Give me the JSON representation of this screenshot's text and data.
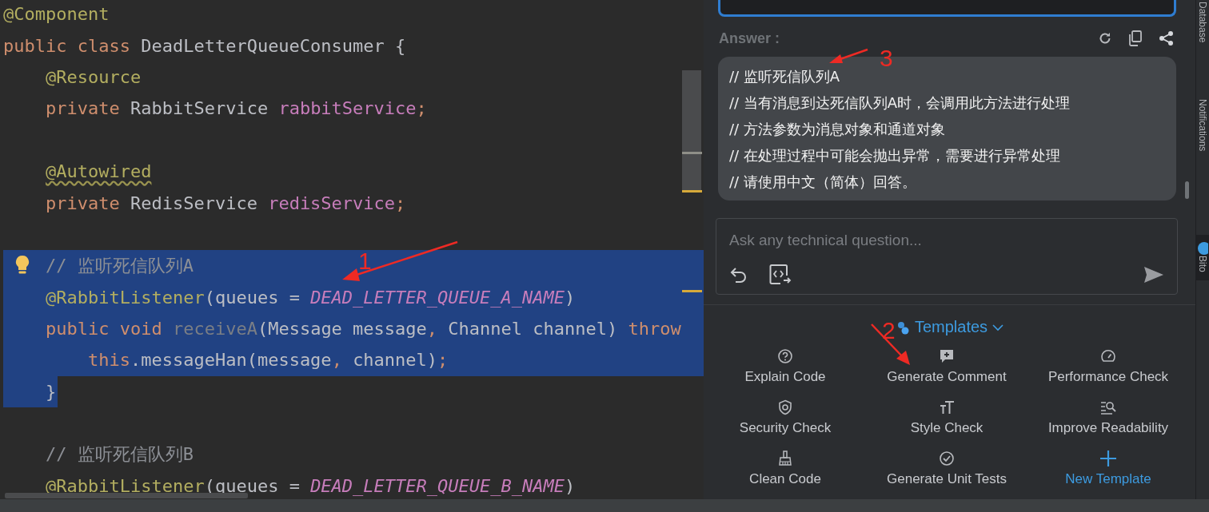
{
  "editor": {
    "lines": [
      {
        "kind": "code",
        "tokens": [
          {
            "kind": "ann",
            "text": "@Component"
          }
        ]
      },
      {
        "kind": "code",
        "tokens": [
          {
            "kind": "kw",
            "text": "public class "
          },
          {
            "kind": "plain",
            "text": "DeadLetterQueueConsumer {"
          }
        ]
      },
      {
        "kind": "code",
        "tokens": [
          {
            "kind": "ann",
            "text": "    @Resource"
          }
        ]
      },
      {
        "kind": "code",
        "tokens": [
          {
            "kind": "kw",
            "text": "    private "
          },
          {
            "kind": "plain",
            "text": "RabbitService "
          },
          {
            "kind": "field",
            "text": "rabbitService"
          },
          {
            "kind": "kw",
            "text": ";"
          }
        ]
      },
      {
        "kind": "blank"
      },
      {
        "kind": "code",
        "tokens": [
          {
            "kind": "ann",
            "text": "    @Autowired",
            "warning": true
          }
        ]
      },
      {
        "kind": "code",
        "tokens": [
          {
            "kind": "kw",
            "text": "    private "
          },
          {
            "kind": "plain",
            "text": "RedisService "
          },
          {
            "kind": "field",
            "text": "redisService"
          },
          {
            "kind": "kw",
            "text": ";"
          }
        ]
      },
      {
        "kind": "blank"
      },
      {
        "kind": "code",
        "selected": true,
        "bulb": true,
        "tokens": [
          {
            "kind": "comment",
            "text": "    // 监听死信队列A"
          }
        ]
      },
      {
        "kind": "code",
        "selected": true,
        "tokens": [
          {
            "kind": "ann",
            "text": "    @RabbitListener"
          },
          {
            "kind": "plain",
            "text": "(queues = "
          },
          {
            "kind": "const",
            "text": "DEAD_LETTER_QUEUE_A_NAME"
          },
          {
            "kind": "plain",
            "text": ")"
          }
        ]
      },
      {
        "kind": "code",
        "selected": true,
        "tokens": [
          {
            "kind": "kw",
            "text": "    public void "
          },
          {
            "kind": "unused",
            "text": "receiveA"
          },
          {
            "kind": "plain",
            "text": "(Message message"
          },
          {
            "kind": "kw",
            "text": ", "
          },
          {
            "kind": "plain",
            "text": "Channel channel) "
          },
          {
            "kind": "kw",
            "text": "throw"
          }
        ]
      },
      {
        "kind": "code",
        "selected": true,
        "tokens": [
          {
            "kind": "kw",
            "text": "        this"
          },
          {
            "kind": "plain",
            "text": ".messageHan(message"
          },
          {
            "kind": "kw",
            "text": ", "
          },
          {
            "kind": "plain",
            "text": "channel)"
          },
          {
            "kind": "kw",
            "text": ";"
          }
        ]
      },
      {
        "kind": "code",
        "selected": true,
        "partial": true,
        "tokens": [
          {
            "kind": "plain",
            "text": "    }"
          }
        ]
      },
      {
        "kind": "blank"
      },
      {
        "kind": "code",
        "tokens": [
          {
            "kind": "comment",
            "text": "    // 监听死信队列B"
          }
        ]
      },
      {
        "kind": "code",
        "tokens": [
          {
            "kind": "ann",
            "text": "    @RabbitListener"
          },
          {
            "kind": "plain",
            "text": "(queues = "
          },
          {
            "kind": "const",
            "text": "DEAD_LETTER_QUEUE_B_NAME"
          },
          {
            "kind": "plain",
            "text": ")"
          }
        ]
      }
    ]
  },
  "assistant": {
    "answer_label": "Answer :",
    "answer_lines": [
      "// 监听死信队列A",
      "// 当有消息到达死信队列A时，会调用此方法进行处理",
      "// 方法参数为消息对象和通道对象",
      "// 在处理过程中可能会抛出异常，需要进行异常处理",
      "// 请使用中文（简体）回答。"
    ],
    "question": {
      "placeholder": "Ask any technical question..."
    },
    "templates": {
      "title": "Templates",
      "expanded": true,
      "items": [
        {
          "kind": "template",
          "label": "Explain Code"
        },
        {
          "kind": "template",
          "label": "Generate Comment"
        },
        {
          "kind": "template",
          "label": "Performance Check"
        },
        {
          "kind": "template",
          "label": "Security Check"
        },
        {
          "kind": "template",
          "label": "Style Check"
        },
        {
          "kind": "template",
          "label": "Improve Readability"
        },
        {
          "kind": "template",
          "label": "Clean Code"
        },
        {
          "kind": "template",
          "label": "Generate Unit Tests"
        },
        {
          "kind": "add",
          "label": "New Template"
        }
      ]
    }
  },
  "side_tabs": [
    "Database",
    "Notifications",
    "Bito"
  ],
  "annotations": [
    {
      "label": "1"
    },
    {
      "label": "2"
    },
    {
      "label": "3"
    }
  ]
}
